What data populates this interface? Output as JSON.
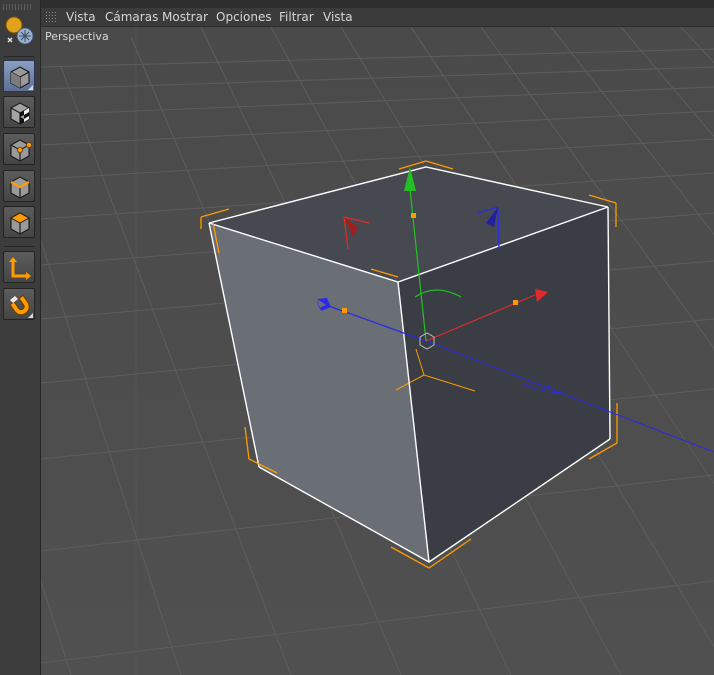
{
  "menu": {
    "items": [
      {
        "label": "Vista"
      },
      {
        "label": "Cámaras"
      },
      {
        "label": "Mostrar"
      },
      {
        "label": "Opciones"
      },
      {
        "label": "Filtrar"
      },
      {
        "label": "Vista"
      }
    ]
  },
  "viewport": {
    "label": "Perspectiva"
  },
  "toolbar": {
    "tools": [
      {
        "icon": "make-editable-icon",
        "active": false
      },
      {
        "icon": "model-mode-icon",
        "active": true
      },
      {
        "icon": "texture-mode-icon",
        "active": false
      },
      {
        "icon": "points-mode-icon",
        "active": false
      },
      {
        "icon": "edges-mode-icon",
        "active": false
      },
      {
        "icon": "polygons-mode-icon",
        "active": false
      },
      {
        "icon": "axis-mode-icon",
        "active": false
      },
      {
        "icon": "snap-magnet-icon",
        "active": false
      }
    ]
  },
  "colors": {
    "selection": "#ff9a00",
    "axis_x": "#e02a2a",
    "axis_y": "#22c022",
    "axis_z": "#2a2ae8",
    "highlight": "#ffffff"
  }
}
